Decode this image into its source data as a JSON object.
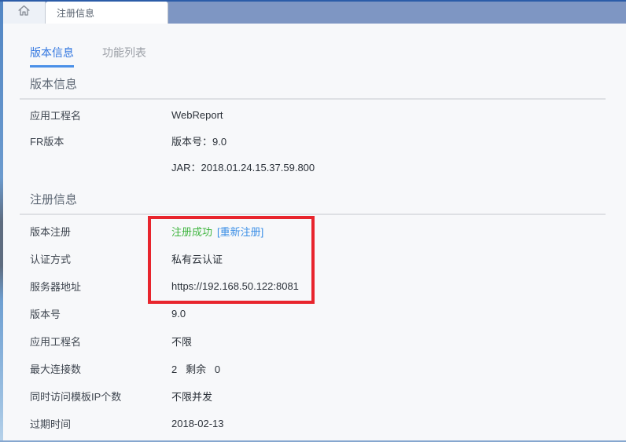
{
  "tab_bar": {
    "home_icon": "home-icon",
    "active_tab_label": "注册信息"
  },
  "subtabs": [
    {
      "label": "版本信息",
      "active": true
    },
    {
      "label": "功能列表",
      "active": false
    }
  ],
  "sections": [
    {
      "title": "版本信息",
      "rows": [
        {
          "label": "应用工程名",
          "value": "WebReport"
        },
        {
          "label": "FR版本",
          "value": "版本号：9.0"
        },
        {
          "label": "",
          "value": "JAR：2018.01.24.15.37.59.800"
        }
      ]
    },
    {
      "title": "注册信息",
      "rows": [
        {
          "label": "版本注册",
          "status": "注册成功",
          "link": "[重新注册]"
        },
        {
          "label": "认证方式",
          "value": "私有云认证"
        },
        {
          "label": "服务器地址",
          "value": "https://192.168.50.122:8081"
        },
        {
          "label": "版本号",
          "value": "9.0"
        },
        {
          "label": "应用工程名",
          "value": "不限"
        },
        {
          "label": "最大连接数",
          "value": "2   剩余   0"
        },
        {
          "label": "同时访问模板IP个数",
          "value": "不限并发"
        },
        {
          "label": "过期时间",
          "value": "2018-02-13"
        }
      ]
    }
  ],
  "annotation": {
    "type": "red-highlight-box"
  },
  "colors": {
    "topbar": "#7e96c3",
    "topbar_edge": "#2b5ca8",
    "content_bg": "#f7f8fa",
    "subtab_active": "#3377e0",
    "subtab_underline": "#4a90e8",
    "status_green": "#3fb53f",
    "link_blue": "#3a8ee6",
    "annotation_red": "#e8252d"
  }
}
